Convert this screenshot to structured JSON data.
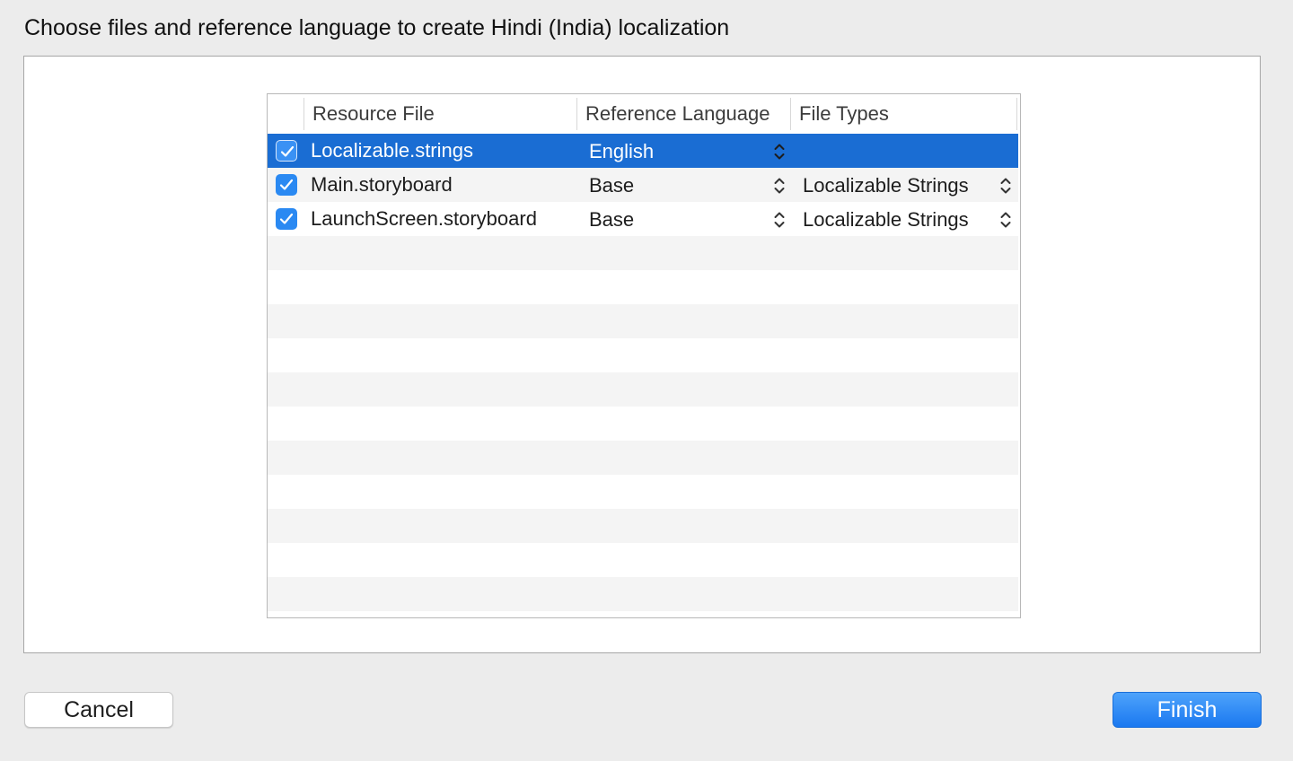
{
  "dialog": {
    "title": "Choose files and reference language to create Hindi (India) localization"
  },
  "table": {
    "columns": [
      "Resource File",
      "Reference Language",
      "File Types"
    ],
    "rows": [
      {
        "checked": true,
        "file": "Localizable.strings",
        "language": "English",
        "file_type": "",
        "selected": true
      },
      {
        "checked": true,
        "file": "Main.storyboard",
        "language": "Base",
        "file_type": "Localizable Strings",
        "selected": false
      },
      {
        "checked": true,
        "file": "LaunchScreen.storyboard",
        "language": "Base",
        "file_type": "Localizable Strings",
        "selected": false
      }
    ]
  },
  "buttons": {
    "cancel_label": "Cancel",
    "finish_label": "Finish"
  },
  "colors": {
    "selection": "#1a6dd3",
    "accent": "#2a89f2",
    "background": "#ececec"
  },
  "icons": {
    "checkbox": "checkmark-icon",
    "stepper": "up-down-chevron-icon"
  }
}
